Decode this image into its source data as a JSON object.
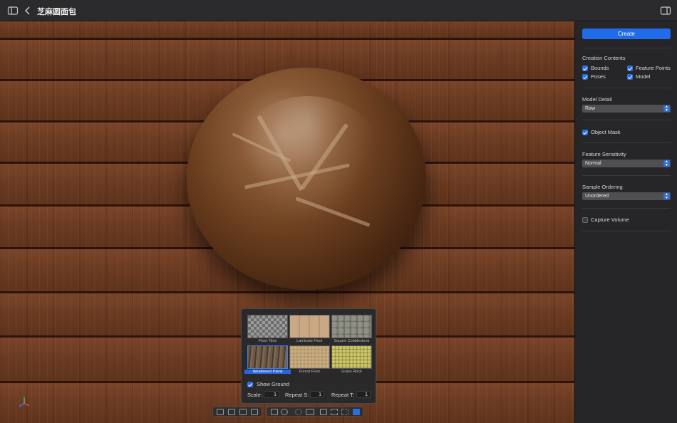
{
  "window": {
    "title": "芝麻圆面包"
  },
  "ground_panel": {
    "materials": [
      {
        "label": "Floor Tiles",
        "selected": false
      },
      {
        "label": "Laminate Floor",
        "selected": false
      },
      {
        "label": "Square Cobblestone",
        "selected": false
      },
      {
        "label": "Weathered Plank",
        "selected": true
      },
      {
        "label": "Forest Floor",
        "selected": false
      },
      {
        "label": "Grass Rock",
        "selected": false
      }
    ],
    "show_ground_label": "Show Ground",
    "show_ground_checked": true,
    "scale_label": "Scale:",
    "scale_value": "1",
    "repeat_s_label": "Repeat S:",
    "repeat_s_value": "1",
    "repeat_t_label": "Repeat T:",
    "repeat_t_value": "1"
  },
  "toolbar": {
    "groups": [
      [
        "frame-icon",
        "cube-frame-icon",
        "crop-icon",
        "image-icon"
      ],
      [
        "grid-icon",
        "contrast-icon",
        "sun-icon",
        "rectangle-icon",
        "box-icon",
        "nodes-icon",
        "dots-grid-icon",
        "ground-icon"
      ]
    ],
    "active": "ground-icon"
  },
  "sidebar": {
    "create_label": "Create",
    "creation_contents": {
      "title": "Creation Contents",
      "options": [
        {
          "label": "Bounds",
          "checked": true
        },
        {
          "label": "Feature Points",
          "checked": true
        },
        {
          "label": "Poses",
          "checked": true
        },
        {
          "label": "Model",
          "checked": true
        }
      ]
    },
    "model_detail": {
      "title": "Model Detail",
      "value": "Raw"
    },
    "object_mask": {
      "label": "Object Mask",
      "checked": true
    },
    "feature_sensitivity": {
      "title": "Feature Sensitivity",
      "value": "Normal"
    },
    "sample_ordering": {
      "title": "Sample Ordering",
      "value": "Unordered"
    },
    "capture_volume": {
      "label": "Capture Volume",
      "checked": false
    }
  },
  "colors": {
    "accent": "#1f6bea",
    "wood": "#6b3b22"
  }
}
